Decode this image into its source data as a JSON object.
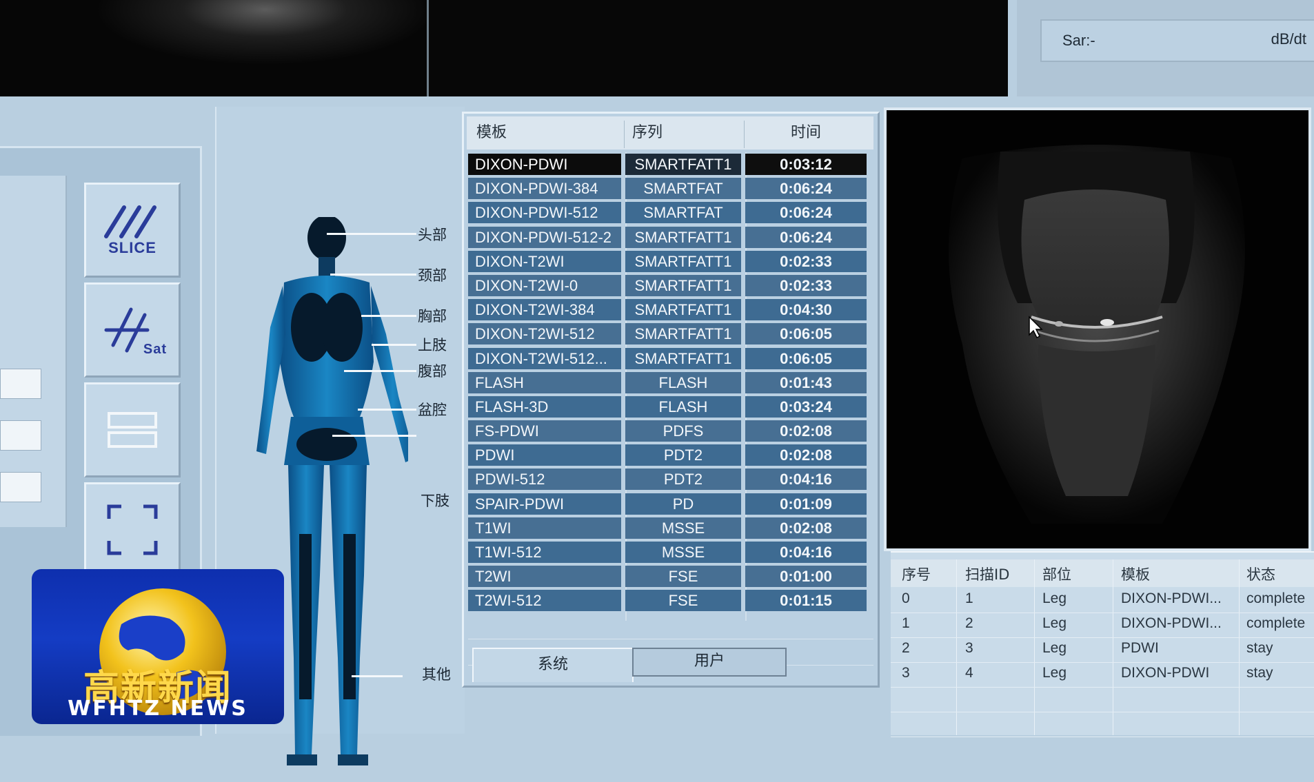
{
  "sar": {
    "label": "Sar:-",
    "unit": "dB/dt"
  },
  "tools": [
    {
      "label": "SLICE",
      "icon": "slice-icon"
    },
    {
      "label": "Sat",
      "icon": "sat-icon"
    },
    {
      "label": "",
      "icon": "stack-icon"
    },
    {
      "label": "",
      "icon": "frame-icon"
    }
  ],
  "body_regions": [
    "头部",
    "颈部",
    "胸部",
    "上肢",
    "腹部",
    "盆腔",
    "下肢",
    "其他"
  ],
  "protocol_table": {
    "headers": [
      "模板",
      "序列",
      "时间"
    ],
    "selected_index": 0,
    "rows": [
      {
        "template": "DIXON-PDWI",
        "sequence": "SMARTFATT1",
        "time": "0:03:12"
      },
      {
        "template": "DIXON-PDWI-384",
        "sequence": "SMARTFAT",
        "time": "0:06:24"
      },
      {
        "template": "DIXON-PDWI-512",
        "sequence": "SMARTFAT",
        "time": "0:06:24"
      },
      {
        "template": "DIXON-PDWI-512-2",
        "sequence": "SMARTFATT1",
        "time": "0:06:24"
      },
      {
        "template": "DIXON-T2WI",
        "sequence": "SMARTFATT1",
        "time": "0:02:33"
      },
      {
        "template": "DIXON-T2WI-0",
        "sequence": "SMARTFATT1",
        "time": "0:02:33"
      },
      {
        "template": "DIXON-T2WI-384",
        "sequence": "SMARTFATT1",
        "time": "0:04:30"
      },
      {
        "template": "DIXON-T2WI-512",
        "sequence": "SMARTFATT1",
        "time": "0:06:05"
      },
      {
        "template": "DIXON-T2WI-512...",
        "sequence": "SMARTFATT1",
        "time": "0:06:05"
      },
      {
        "template": "FLASH",
        "sequence": "FLASH",
        "time": "0:01:43"
      },
      {
        "template": "FLASH-3D",
        "sequence": "FLASH",
        "time": "0:03:24"
      },
      {
        "template": "FS-PDWI",
        "sequence": "PDFS",
        "time": "0:02:08"
      },
      {
        "template": "PDWI",
        "sequence": "PDT2",
        "time": "0:02:08"
      },
      {
        "template": "PDWI-512",
        "sequence": "PDT2",
        "time": "0:04:16"
      },
      {
        "template": "SPAIR-PDWI",
        "sequence": "PD",
        "time": "0:01:09"
      },
      {
        "template": "T1WI",
        "sequence": "MSSE",
        "time": "0:02:08"
      },
      {
        "template": "T1WI-512",
        "sequence": "MSSE",
        "time": "0:04:16"
      },
      {
        "template": "T2WI",
        "sequence": "FSE",
        "time": "0:01:00"
      },
      {
        "template": "T2WI-512",
        "sequence": "FSE",
        "time": "0:01:15"
      }
    ],
    "tabs": {
      "system": "系统",
      "user": "用户"
    }
  },
  "scan_list": {
    "headers": [
      "序号",
      "扫描ID",
      "部位",
      "模板",
      "状态"
    ],
    "rows": [
      {
        "no": "0",
        "scan_id": "1",
        "region": "Leg",
        "template": "DIXON-PDWI...",
        "status": "complete"
      },
      {
        "no": "1",
        "scan_id": "2",
        "region": "Leg",
        "template": "DIXON-PDWI...",
        "status": "complete"
      },
      {
        "no": "2",
        "scan_id": "3",
        "region": "Leg",
        "template": "PDWI",
        "status": "stay"
      },
      {
        "no": "3",
        "scan_id": "4",
        "region": "Leg",
        "template": "DIXON-PDWI",
        "status": "stay"
      }
    ]
  },
  "logo": {
    "cn": "高新新闻",
    "en": "WFHTZ NEWS"
  },
  "colors": {
    "panel_bg": "#b9cfe0",
    "row_bg": "#3e6b92",
    "selected_bg": "#0c0c0c",
    "brand_blue": "#143cc4",
    "brand_gold": "#ffd84a"
  }
}
